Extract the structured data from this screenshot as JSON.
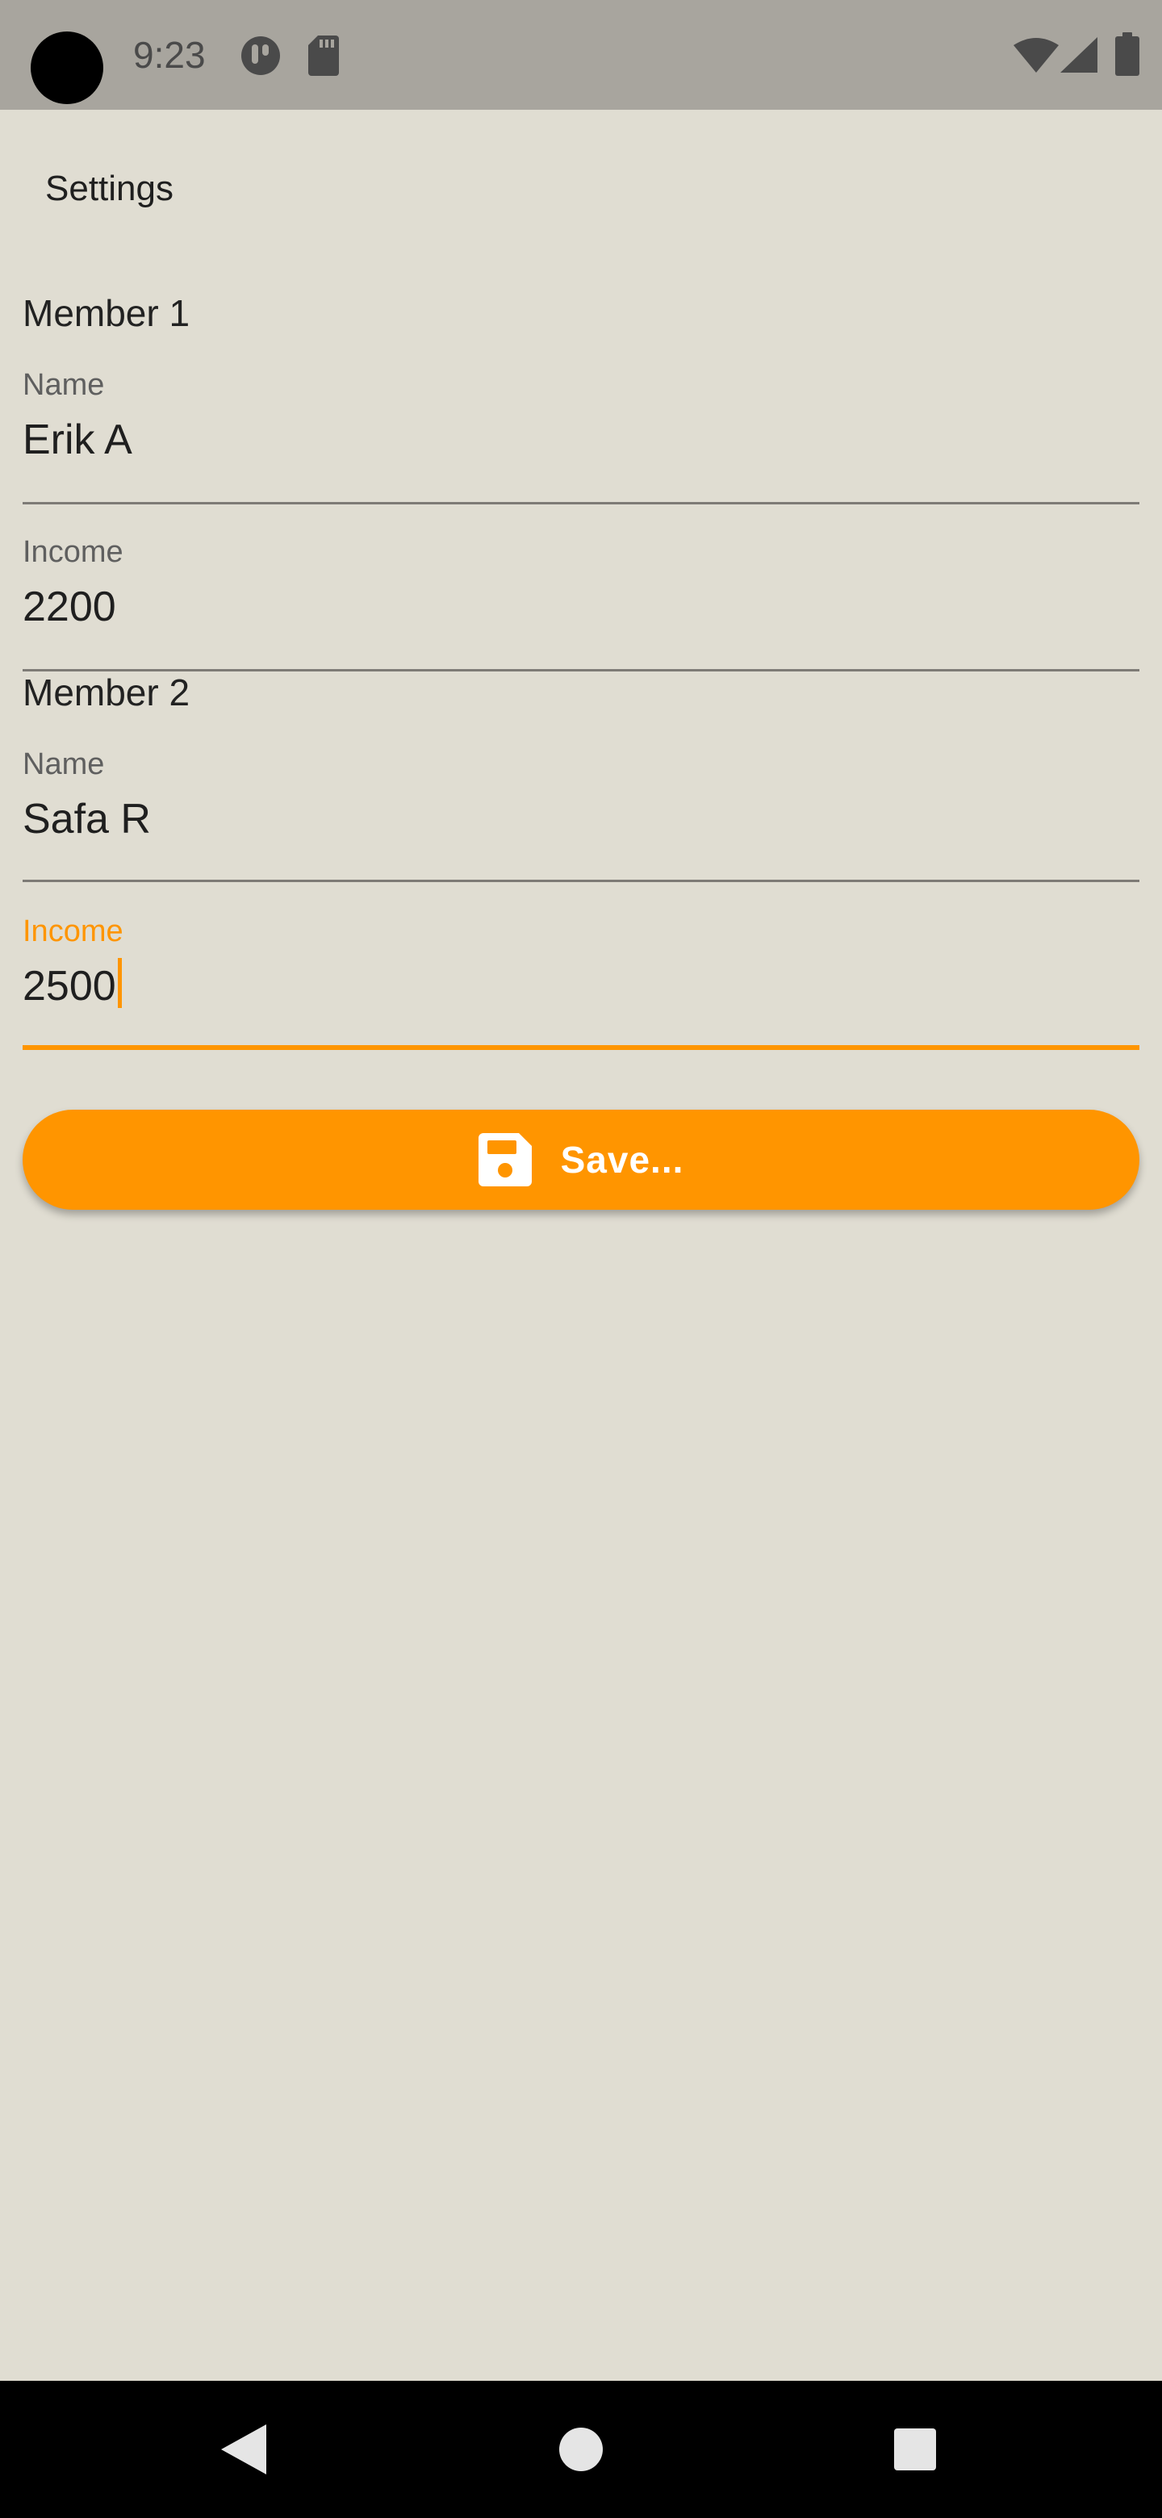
{
  "status_bar": {
    "time": "9:23",
    "icons": [
      "app-notification-icon",
      "sd-card-icon",
      "wifi-icon",
      "cellular-signal-icon",
      "battery-icon"
    ]
  },
  "app_bar": {
    "title": "Settings"
  },
  "members": [
    {
      "header": "Member 1",
      "name_field": {
        "label": "Name",
        "value": "Erik A"
      },
      "income_field": {
        "label": "Income",
        "value": "2200"
      }
    },
    {
      "header": "Member 2",
      "name_field": {
        "label": "Name",
        "value": "Safa R"
      },
      "income_field": {
        "label": "Income",
        "value": "2500",
        "focused": true
      }
    }
  ],
  "save_button": {
    "label": "Save...",
    "icon": "floppy-disk-icon"
  },
  "nav_bar": {
    "buttons": [
      "back-icon",
      "home-icon",
      "recents-icon"
    ]
  },
  "colors": {
    "accent": "#ff9500",
    "background": "#e0ddd2",
    "status_bar": "#a8a59e",
    "nav_bar": "#000000"
  }
}
